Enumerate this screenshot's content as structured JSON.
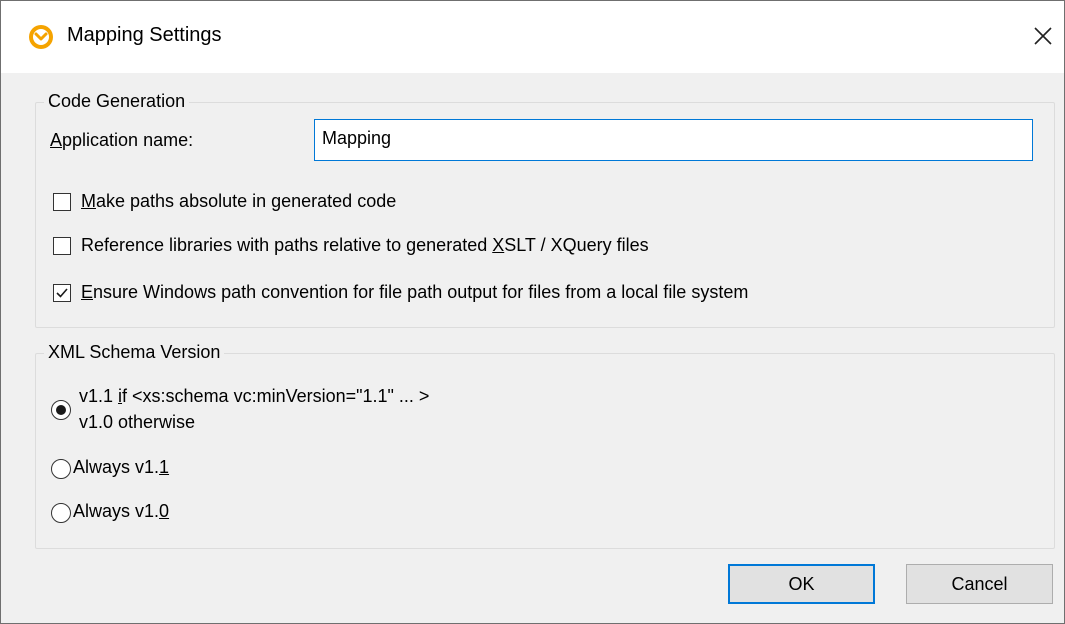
{
  "window": {
    "title": "Mapping Settings",
    "close_icon": "close-icon",
    "app_icon": "mapforce-app-icon"
  },
  "code_generation": {
    "legend": "Code Generation",
    "app_name_label": {
      "mnemonic": "A",
      "rest": "pplication name:"
    },
    "app_name_value": "Mapping",
    "checkboxes": [
      {
        "mnemonic": "M",
        "before": "",
        "rest": "ake paths absolute in generated code",
        "checked": false
      },
      {
        "before": "Reference libraries with paths relative to generated ",
        "mnemonic": "X",
        "rest": "SLT / XQuery files",
        "checked": false
      },
      {
        "mnemonic": "E",
        "before": "",
        "rest": "nsure Windows path convention for file path output for files from a local file system",
        "checked": true
      }
    ]
  },
  "xml_schema": {
    "legend": "XML Schema Version",
    "options": [
      {
        "before": "v1.1 ",
        "mnemonic": "i",
        "rest": "f <xs:schema vc:minVersion=\"1.1\" ... >",
        "line2": "v1.0 otherwise",
        "selected": true
      },
      {
        "before": "Always v1.",
        "mnemonic": "1",
        "rest": "",
        "selected": false
      },
      {
        "before": "Always v1.",
        "mnemonic": "0",
        "rest": "",
        "selected": false
      }
    ]
  },
  "buttons": {
    "ok": "OK",
    "cancel": "Cancel"
  },
  "colors": {
    "accent": "#0078d7",
    "dialog_bg": "#f0f0f0",
    "icon_orange": "#f5a300"
  }
}
